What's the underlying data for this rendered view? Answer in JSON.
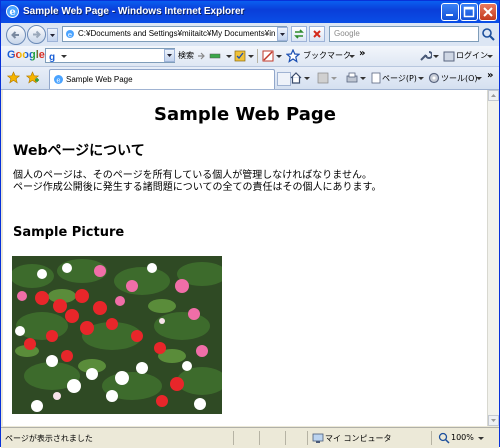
{
  "window": {
    "title": "Sample Web Page - Windows Internet Explorer"
  },
  "address_bar": {
    "url": "C:¥Documents and Settings¥miitaitc¥My Documents¥in",
    "search_placeholder": "Google"
  },
  "google_toolbar": {
    "logo": "Google",
    "search_label": "検索",
    "bookmarks_label": "ブックマーク",
    "more": "»",
    "login_label": "ログイン"
  },
  "tabs": [
    {
      "label": "Sample Web Page"
    }
  ],
  "command_bar": {
    "page_label": "ページ(P)",
    "tools_label": "ツール(O)",
    "more": "»"
  },
  "page": {
    "heading": "Sample Web Page",
    "section_title": "Webページについて",
    "paragraph_line1": "個人のページは、そのページを所有している個人が管理しなければなりません。",
    "paragraph_line2": "ページ作成公開後に発生する諸問題についての全ての責任はその個人にあります。",
    "picture_title": "Sample Picture"
  },
  "status_bar": {
    "text": "ページが表示されました",
    "zone": "マイ コンピュータ",
    "zoom": "100%"
  },
  "colors": {
    "titlebar": "#0a4ee6",
    "window_border": "#0831d9",
    "chrome": "#ece9d8"
  }
}
